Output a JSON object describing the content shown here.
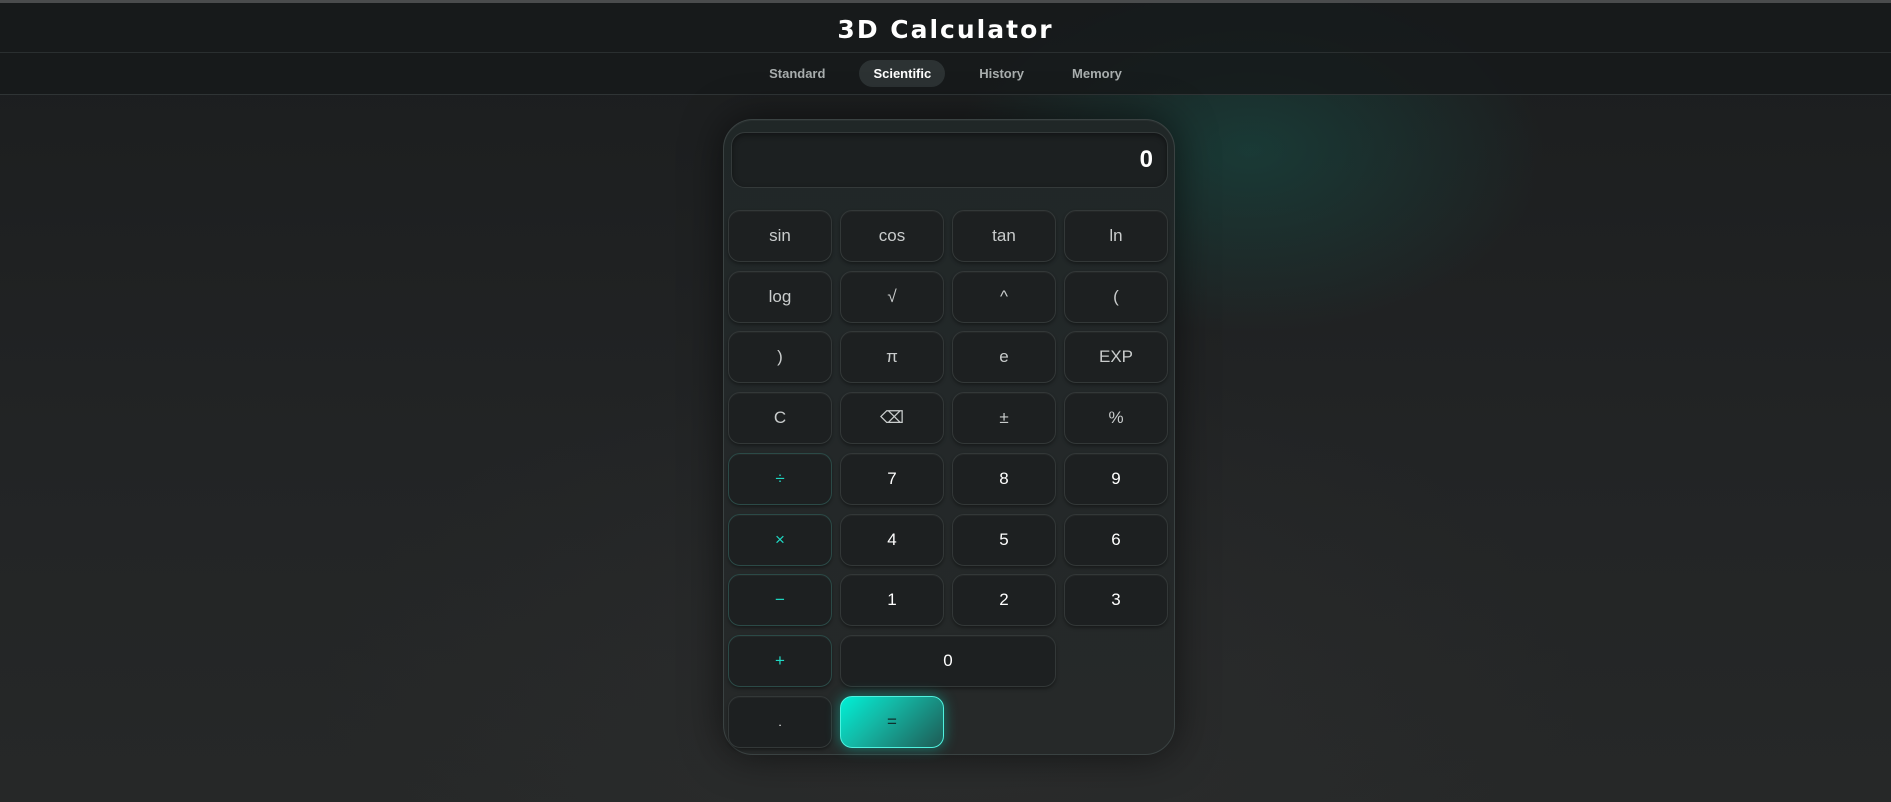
{
  "app": {
    "title": "3D Calculator"
  },
  "tabs": [
    {
      "label": "Standard",
      "active": false
    },
    {
      "label": "Scientific",
      "active": true
    },
    {
      "label": "History",
      "active": false
    },
    {
      "label": "Memory",
      "active": false
    }
  ],
  "display": {
    "value": "0"
  },
  "keys": {
    "sin": "sin",
    "cos": "cos",
    "tan": "tan",
    "ln": "ln",
    "log": "log",
    "sqrt": "√",
    "pow": "^",
    "lparen": "(",
    "rparen": ")",
    "pi": "π",
    "e": "e",
    "exp": "EXP",
    "clear": "C",
    "backspace": "⌫",
    "plusminus": "±",
    "percent": "%",
    "divide": "÷",
    "seven": "7",
    "eight": "8",
    "nine": "9",
    "multiply": "×",
    "four": "4",
    "five": "5",
    "six": "6",
    "minus": "−",
    "one": "1",
    "two": "2",
    "three": "3",
    "plus": "+",
    "zero": "0",
    "decimal": ".",
    "equals": "="
  },
  "colors": {
    "accent": "#1fd8c3",
    "equals_gradient_start": "#00f0d6",
    "background": "#1f2122"
  }
}
